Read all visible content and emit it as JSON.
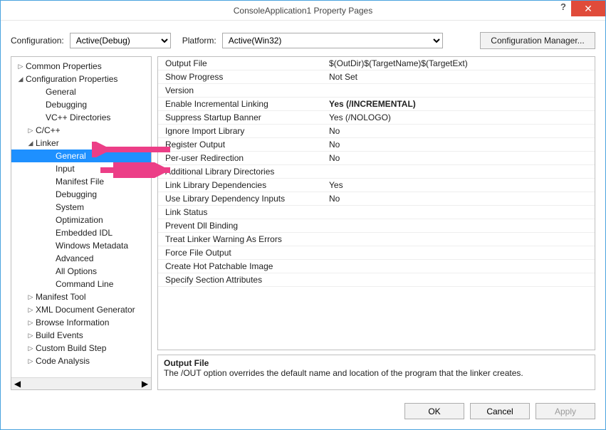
{
  "window": {
    "title": "ConsoleApplication1 Property Pages",
    "help_glyph": "?",
    "close_glyph": "✕"
  },
  "configrow": {
    "label_configuration": "Configuration:",
    "configuration_value": "Active(Debug)",
    "label_platform": "Platform:",
    "platform_value": "Active(Win32)",
    "config_manager_label": "Configuration Manager..."
  },
  "tree": [
    {
      "indent": 0,
      "caret": "▷",
      "label": "Common Properties",
      "sel": false
    },
    {
      "indent": 0,
      "caret": "◢",
      "label": "Configuration Properties",
      "sel": false
    },
    {
      "indent": 2,
      "caret": "",
      "label": "General",
      "sel": false
    },
    {
      "indent": 2,
      "caret": "",
      "label": "Debugging",
      "sel": false
    },
    {
      "indent": 2,
      "caret": "",
      "label": "VC++ Directories",
      "sel": false
    },
    {
      "indent": 1,
      "caret": "▷",
      "label": "C/C++",
      "sel": false
    },
    {
      "indent": 1,
      "caret": "◢",
      "label": "Linker",
      "sel": false
    },
    {
      "indent": 3,
      "caret": "",
      "label": "General",
      "sel": true
    },
    {
      "indent": 3,
      "caret": "",
      "label": "Input",
      "sel": false
    },
    {
      "indent": 3,
      "caret": "",
      "label": "Manifest File",
      "sel": false
    },
    {
      "indent": 3,
      "caret": "",
      "label": "Debugging",
      "sel": false
    },
    {
      "indent": 3,
      "caret": "",
      "label": "System",
      "sel": false
    },
    {
      "indent": 3,
      "caret": "",
      "label": "Optimization",
      "sel": false
    },
    {
      "indent": 3,
      "caret": "",
      "label": "Embedded IDL",
      "sel": false
    },
    {
      "indent": 3,
      "caret": "",
      "label": "Windows Metadata",
      "sel": false
    },
    {
      "indent": 3,
      "caret": "",
      "label": "Advanced",
      "sel": false
    },
    {
      "indent": 3,
      "caret": "",
      "label": "All Options",
      "sel": false
    },
    {
      "indent": 3,
      "caret": "",
      "label": "Command Line",
      "sel": false
    },
    {
      "indent": 1,
      "caret": "▷",
      "label": "Manifest Tool",
      "sel": false
    },
    {
      "indent": 1,
      "caret": "▷",
      "label": "XML Document Generator",
      "sel": false
    },
    {
      "indent": 1,
      "caret": "▷",
      "label": "Browse Information",
      "sel": false
    },
    {
      "indent": 1,
      "caret": "▷",
      "label": "Build Events",
      "sel": false
    },
    {
      "indent": 1,
      "caret": "▷",
      "label": "Custom Build Step",
      "sel": false
    },
    {
      "indent": 1,
      "caret": "▷",
      "label": "Code Analysis",
      "sel": false
    }
  ],
  "grid": [
    {
      "label": "Output File",
      "value": "$(OutDir)$(TargetName)$(TargetExt)",
      "bold": false
    },
    {
      "label": "Show Progress",
      "value": "Not Set",
      "bold": false
    },
    {
      "label": "Version",
      "value": "",
      "bold": false
    },
    {
      "label": "Enable Incremental Linking",
      "value": "Yes (/INCREMENTAL)",
      "bold": true
    },
    {
      "label": "Suppress Startup Banner",
      "value": "Yes (/NOLOGO)",
      "bold": false
    },
    {
      "label": "Ignore Import Library",
      "value": "No",
      "bold": false
    },
    {
      "label": "Register Output",
      "value": "No",
      "bold": false
    },
    {
      "label": "Per-user Redirection",
      "value": "No",
      "bold": false
    },
    {
      "label": "Additional Library Directories",
      "value": "",
      "bold": false
    },
    {
      "label": "Link Library Dependencies",
      "value": "Yes",
      "bold": false
    },
    {
      "label": "Use Library Dependency Inputs",
      "value": "No",
      "bold": false
    },
    {
      "label": "Link Status",
      "value": "",
      "bold": false
    },
    {
      "label": "Prevent Dll Binding",
      "value": "",
      "bold": false
    },
    {
      "label": "Treat Linker Warning As Errors",
      "value": "",
      "bold": false
    },
    {
      "label": "Force File Output",
      "value": "",
      "bold": false
    },
    {
      "label": "Create Hot Patchable Image",
      "value": "",
      "bold": false
    },
    {
      "label": "Specify Section Attributes",
      "value": "",
      "bold": false
    }
  ],
  "description": {
    "title": "Output File",
    "body": "The /OUT option overrides the default name and location of the program that the linker creates."
  },
  "footer": {
    "ok": "OK",
    "cancel": "Cancel",
    "apply": "Apply"
  },
  "scroll": {
    "left": "◀",
    "right": "▶"
  }
}
